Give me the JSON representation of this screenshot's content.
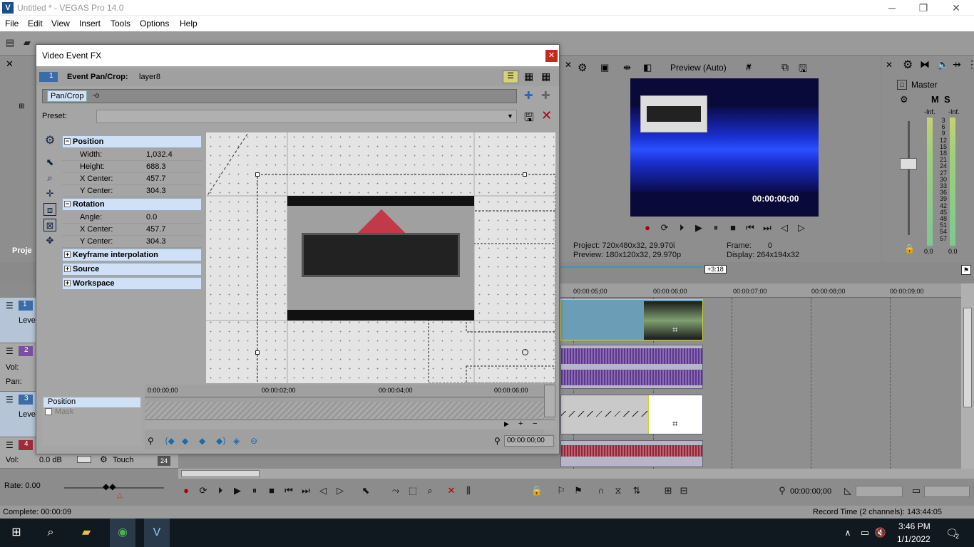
{
  "window": {
    "title": "Untitled * - VEGAS Pro 14.0",
    "minimize": "─",
    "restore": "❐",
    "close": "✕"
  },
  "menu": [
    "File",
    "Edit",
    "View",
    "Insert",
    "Tools",
    "Options",
    "Help"
  ],
  "dialog": {
    "title": "Video Event FX",
    "close": "✕",
    "track_num": "1",
    "event_label": "Event Pan/Crop:",
    "event_value": "layer8",
    "chain_item": "Pan/Crop",
    "preset_label": "Preset:",
    "preset_value": "",
    "sections": {
      "position": {
        "title": "Position",
        "rows": [
          {
            "k": "Width:",
            "v": "1,032.4"
          },
          {
            "k": "Height:",
            "v": "688.3"
          },
          {
            "k": "X Center:",
            "v": "457.7"
          },
          {
            "k": "Y Center:",
            "v": "304.3"
          }
        ]
      },
      "rotation": {
        "title": "Rotation",
        "rows": [
          {
            "k": "Angle:",
            "v": "0.0"
          },
          {
            "k": "X Center:",
            "v": "457.7"
          },
          {
            "k": "Y Center:",
            "v": "304.3"
          }
        ]
      },
      "keyframe": "Keyframe interpolation",
      "source": "Source",
      "workspace": "Workspace"
    },
    "kf_tracks": [
      "Position",
      "Mask"
    ],
    "kf_ruler": [
      "0:00:00;00",
      "00:00:02;00",
      "00:00:04;00",
      "00:00:06;00"
    ],
    "kf_time": "00:00:00;00"
  },
  "preview": {
    "mode": "Preview (Auto)",
    "timecode": "00:00:00;00",
    "project_label": "Project:",
    "project_value": "720x480x32, 29.970i",
    "preview_label": "Preview:",
    "preview_value": "180x120x32, 29.970p",
    "frame_label": "Frame:",
    "frame_value": "0",
    "display_label": "Display:",
    "display_value": "264x194x32"
  },
  "mixer": {
    "label": "Master",
    "m": "M",
    "s": "S",
    "inf_left": "-Inf.",
    "inf_right": "-Inf.",
    "scale": [
      "3",
      "6",
      "9",
      "12",
      "15",
      "18",
      "21",
      "24",
      "27",
      "30",
      "33",
      "36",
      "39",
      "42",
      "45",
      "48",
      "51",
      "54",
      "57"
    ],
    "val_left": "0.0",
    "val_right": "0.0"
  },
  "timeline": {
    "length_badge": "+3:18",
    "ruler": [
      "00:00:05;00",
      "00:00:06;00",
      "00:00:07;00",
      "00:00:08;00",
      "00:00:09;00"
    ],
    "tracks": [
      {
        "num": "1",
        "label": "Leve"
      },
      {
        "num": "2",
        "vol": "Vol:",
        "pan": "Pan:"
      },
      {
        "num": "3",
        "label": "Leve"
      },
      {
        "num": "4",
        "vol": "Vol:",
        "vol_value": "0.0 dB",
        "touch": "Touch"
      }
    ],
    "project_tab": "Proje",
    "badge_24": "24"
  },
  "transport": {
    "rate": "Rate: 0.00",
    "timecode": "00:00:00;00"
  },
  "status": {
    "left": "Complete: 00:00:09",
    "right": "Record Time (2 channels): 143:44:05"
  },
  "taskbar": {
    "time": "3:46 PM",
    "date": "1/1/2022",
    "notif": "2"
  },
  "colors": {
    "accent": "#1a4f8b",
    "close": "#c42b1c",
    "propHeader": "#cfe0f7"
  }
}
